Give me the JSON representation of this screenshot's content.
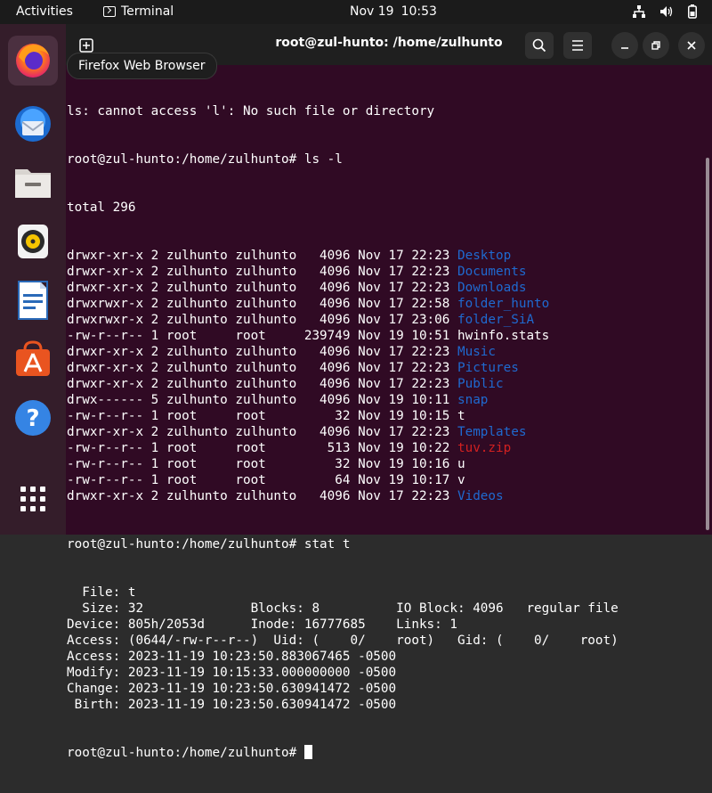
{
  "topbar": {
    "activities": "Activities",
    "app_name": "Terminal",
    "date": "Nov 19",
    "time": "10:53"
  },
  "tooltip": "Firefox Web Browser",
  "dock": {
    "items": [
      "firefox",
      "thunderbird",
      "files",
      "rhythmbox",
      "libreoffice-writer",
      "app-center",
      "help",
      "show-apps"
    ]
  },
  "window": {
    "title": "root@zul-hunto: /home/zulhunto"
  },
  "terminal": {
    "partial_line": "ls: cannot access 'l': No such file or directory",
    "prompt": "root@zul-hunto:/home/zulhunto#",
    "cmd1": " ls -l",
    "total": "total 296",
    "entries": [
      {
        "perm": "drwxr-xr-x 2 zulhunto zulhunto   4096 Nov 17 22:23 ",
        "name": "Desktop",
        "type": "dir"
      },
      {
        "perm": "drwxr-xr-x 2 zulhunto zulhunto   4096 Nov 17 22:23 ",
        "name": "Documents",
        "type": "dir"
      },
      {
        "perm": "drwxr-xr-x 2 zulhunto zulhunto   4096 Nov 17 22:23 ",
        "name": "Downloads",
        "type": "dir"
      },
      {
        "perm": "drwxrwxr-x 2 zulhunto zulhunto   4096 Nov 17 22:58 ",
        "name": "folder_hunto",
        "type": "dir"
      },
      {
        "perm": "drwxrwxr-x 2 zulhunto zulhunto   4096 Nov 17 23:06 ",
        "name": "folder_SiA",
        "type": "dir"
      },
      {
        "perm": "-rw-r--r-- 1 root     root     239749 Nov 19 10:51 ",
        "name": "hwinfo.stats",
        "type": "file"
      },
      {
        "perm": "drwxr-xr-x 2 zulhunto zulhunto   4096 Nov 17 22:23 ",
        "name": "Music",
        "type": "dir"
      },
      {
        "perm": "drwxr-xr-x 2 zulhunto zulhunto   4096 Nov 17 22:23 ",
        "name": "Pictures",
        "type": "dir"
      },
      {
        "perm": "drwxr-xr-x 2 zulhunto zulhunto   4096 Nov 17 22:23 ",
        "name": "Public",
        "type": "dir"
      },
      {
        "perm": "drwx------ 5 zulhunto zulhunto   4096 Nov 19 10:11 ",
        "name": "snap",
        "type": "dir"
      },
      {
        "perm": "-rw-r--r-- 1 root     root         32 Nov 19 10:15 ",
        "name": "t",
        "type": "file"
      },
      {
        "perm": "drwxr-xr-x 2 zulhunto zulhunto   4096 Nov 17 22:23 ",
        "name": "Templates",
        "type": "dir"
      },
      {
        "perm": "-rw-r--r-- 1 root     root        513 Nov 19 10:22 ",
        "name": "tuv.zip",
        "type": "zip"
      },
      {
        "perm": "-rw-r--r-- 1 root     root         32 Nov 19 10:16 ",
        "name": "u",
        "type": "file"
      },
      {
        "perm": "-rw-r--r-- 1 root     root         64 Nov 19 10:17 ",
        "name": "v",
        "type": "file"
      },
      {
        "perm": "drwxr-xr-x 2 zulhunto zulhunto   4096 Nov 17 22:23 ",
        "name": "Videos",
        "type": "dir"
      }
    ],
    "cmd2": " stat t",
    "stat_lines": [
      "  File: t",
      "  Size: 32              Blocks: 8          IO Block: 4096   regular file",
      "Device: 805h/2053d      Inode: 16777685    Links: 1",
      "Access: (0644/-rw-r--r--)  Uid: (    0/    root)   Gid: (    0/    root)",
      "Access: 2023-11-19 10:23:50.883067465 -0500",
      "Modify: 2023-11-19 10:15:33.000000000 -0500",
      "Change: 2023-11-19 10:23:50.630941472 -0500",
      " Birth: 2023-11-19 10:23:50.630941472 -0500"
    ]
  },
  "colors": {
    "terminal_bg": "#300a24",
    "dir": "#1f6ad0",
    "archive": "#d22020",
    "dock_bg": "#341d2a"
  }
}
